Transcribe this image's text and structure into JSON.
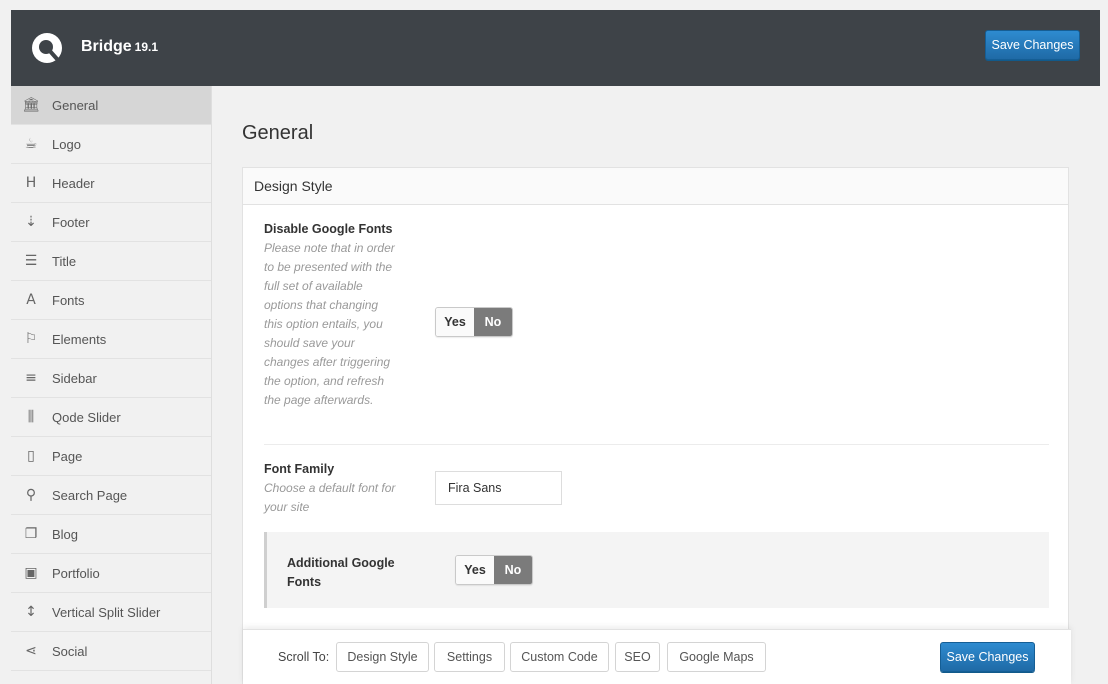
{
  "app": {
    "name": "Bridge",
    "version": "19.1",
    "save_label": "Save Changes"
  },
  "sidebar": {
    "items": [
      {
        "label": "General",
        "icon": "bank-icon",
        "glyph": "🏛",
        "active": true
      },
      {
        "label": "Logo",
        "icon": "mug-icon",
        "glyph": "☕"
      },
      {
        "label": "Header",
        "icon": "header-icon",
        "glyph": "H"
      },
      {
        "label": "Footer",
        "icon": "sort-icon",
        "glyph": "⇣"
      },
      {
        "label": "Title",
        "icon": "card-icon",
        "glyph": "☰"
      },
      {
        "label": "Fonts",
        "icon": "font-icon",
        "glyph": "A"
      },
      {
        "label": "Elements",
        "icon": "flag-icon",
        "glyph": "⚐"
      },
      {
        "label": "Sidebar",
        "icon": "menu-icon",
        "glyph": "≡"
      },
      {
        "label": "Qode Slider",
        "icon": "sliders-icon",
        "glyph": "⫼"
      },
      {
        "label": "Page",
        "icon": "page-icon",
        "glyph": "▯"
      },
      {
        "label": "Search Page",
        "icon": "search-icon",
        "glyph": "⚲"
      },
      {
        "label": "Blog",
        "icon": "copy-icon",
        "glyph": "❐"
      },
      {
        "label": "Portfolio",
        "icon": "portfolio-icon",
        "glyph": "▣"
      },
      {
        "label": "Vertical Split Slider",
        "icon": "vertical-arrows-icon",
        "glyph": "↕"
      },
      {
        "label": "Social",
        "icon": "share-icon",
        "glyph": "⋖"
      }
    ]
  },
  "main": {
    "title": "General",
    "section": "Design Style",
    "disable_google_fonts": {
      "title": "Disable Google Fonts",
      "desc": "Please note that in order to be presented with the full set of available options that changing this option entails, you should save your changes after triggering the option, and refresh the page afterwards.",
      "yes": "Yes",
      "no": "No",
      "selected": "No"
    },
    "font_family": {
      "title": "Font Family",
      "desc": "Choose a default font for your site",
      "value": "Fira Sans"
    },
    "additional_google_fonts": {
      "title": "Additional Google Fonts",
      "yes": "Yes",
      "no": "No",
      "selected": "No"
    }
  },
  "bottom_bar": {
    "scroll_to": "Scroll To:",
    "buttons": [
      "Design Style",
      "Settings",
      "Custom Code",
      "SEO",
      "Google Maps"
    ],
    "save_label": "Save Changes"
  },
  "colors": {
    "topbar": "#3e4348",
    "accent": "#2271b1",
    "toggle_active": "#7b7b7b"
  }
}
